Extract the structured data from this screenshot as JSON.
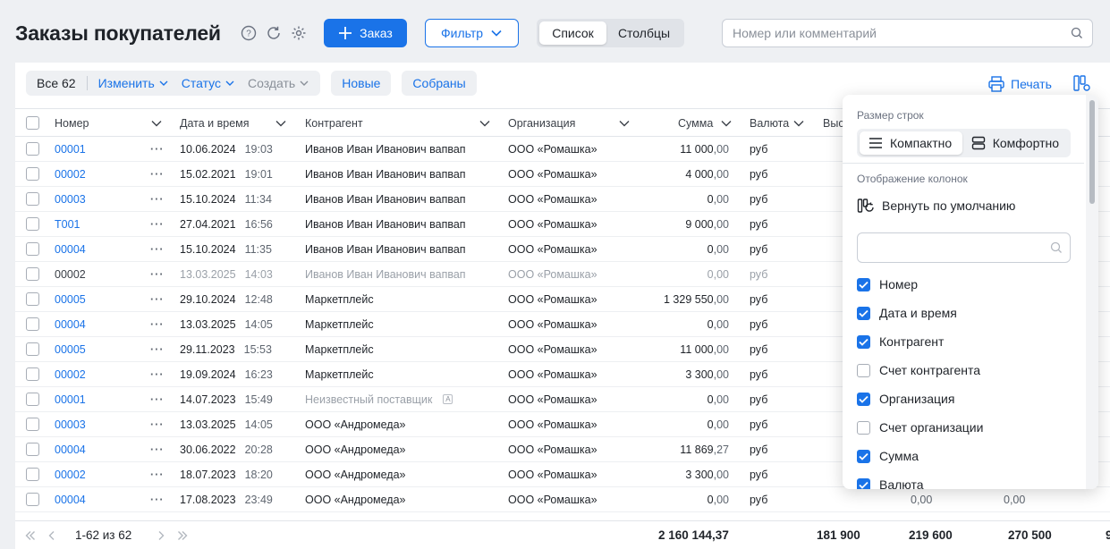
{
  "header": {
    "title": "Заказы покупателей",
    "order_button": "Заказ",
    "filter_button": "Фильтр",
    "view_tabs": [
      "Список",
      "Столбцы"
    ],
    "search_placeholder": "Номер или комментарий"
  },
  "toolbar": {
    "all_label": "Все 62",
    "edit": "Изменить",
    "status": "Статус",
    "create": "Создать",
    "chip_new": "Новые",
    "chip_collected": "Собраны",
    "print": "Печать"
  },
  "columns": [
    "Номер",
    "Дата и время",
    "Контрагент",
    "Организация",
    "Сумма",
    "Валюта",
    "Выс"
  ],
  "rows": [
    {
      "num": "00001",
      "date": "10.06.2024",
      "time": "19:03",
      "party": "Иванов Иван Иванович вапвап",
      "org": "ООО «Ромашка»",
      "sum_int": "11 000",
      "sum_dec": ",00",
      "cur": "руб",
      "style": "link"
    },
    {
      "num": "00002",
      "date": "15.02.2021",
      "time": "19:01",
      "party": "Иванов Иван Иванович вапвап",
      "org": "ООО «Ромашка»",
      "sum_int": "4 000",
      "sum_dec": ",00",
      "cur": "руб",
      "style": "link"
    },
    {
      "num": "00003",
      "date": "15.10.2024",
      "time": "11:34",
      "party": "Иванов Иван Иванович вапвап",
      "org": "ООО «Ромашка»",
      "sum_int": "0",
      "sum_dec": ",00",
      "cur": "руб",
      "style": "link"
    },
    {
      "num": "T001",
      "date": "27.04.2021",
      "time": "16:56",
      "party": "Иванов Иван Иванович вапвап",
      "org": "ООО «Ромашка»",
      "sum_int": "9 000",
      "sum_dec": ",00",
      "cur": "руб",
      "style": "link"
    },
    {
      "num": "00004",
      "date": "15.10.2024",
      "time": "11:35",
      "party": "Иванов Иван Иванович вапвап",
      "org": "ООО «Ромашка»",
      "sum_int": "0",
      "sum_dec": ",00",
      "cur": "руб",
      "style": "link"
    },
    {
      "num": "00002",
      "date": "13.03.2025",
      "time": "14:03",
      "party": "Иванов Иван Иванович вапвап",
      "org": "ООО «Ромашка»",
      "sum_int": "0",
      "sum_dec": ",00",
      "cur": "руб",
      "style": "dim"
    },
    {
      "num": "00005",
      "date": "29.10.2024",
      "time": "12:48",
      "party": "Маркетплейс",
      "org": "ООО «Ромашка»",
      "sum_int": "1 329 550",
      "sum_dec": ",00",
      "cur": "руб",
      "style": "link"
    },
    {
      "num": "00004",
      "date": "13.03.2025",
      "time": "14:05",
      "party": "Маркетплейс",
      "org": "ООО «Ромашка»",
      "sum_int": "0",
      "sum_dec": ",00",
      "cur": "руб",
      "style": "link"
    },
    {
      "num": "00005",
      "date": "29.11.2023",
      "time": "15:53",
      "party": "Маркетплейс",
      "org": "ООО «Ромашка»",
      "sum_int": "11 000",
      "sum_dec": ",00",
      "cur": "руб",
      "style": "link"
    },
    {
      "num": "00002",
      "date": "19.09.2024",
      "time": "16:23",
      "party": "Маркетплейс",
      "org": "ООО «Ромашка»",
      "sum_int": "3 300",
      "sum_dec": ",00",
      "cur": "руб",
      "style": "link"
    },
    {
      "num": "00001",
      "date": "14.07.2023",
      "time": "15:49",
      "party": "Неизвестный поставщик",
      "org": "ООО «Ромашка»",
      "sum_int": "0",
      "sum_dec": ",00",
      "cur": "руб",
      "style": "link",
      "party_dim": true
    },
    {
      "num": "00003",
      "date": "13.03.2025",
      "time": "14:05",
      "party": "ООО «Андромеда»",
      "org": "ООО «Ромашка»",
      "sum_int": "0",
      "sum_dec": ",00",
      "cur": "руб",
      "style": "link"
    },
    {
      "num": "00004",
      "date": "30.06.2022",
      "time": "20:28",
      "party": "ООО «Андромеда»",
      "org": "ООО «Ромашка»",
      "sum_int": "11 869",
      "sum_dec": ",27",
      "cur": "руб",
      "style": "link"
    },
    {
      "num": "00002",
      "date": "18.07.2023",
      "time": "18:20",
      "party": "ООО «Андромеда»",
      "org": "ООО «Ромашка»",
      "sum_int": "3 300",
      "sum_dec": ",00",
      "cur": "руб",
      "style": "link"
    },
    {
      "num": "00004",
      "date": "17.08.2023",
      "time": "23:49",
      "party": "ООО «Андромеда»",
      "org": "ООО «Ромашка»",
      "sum_int": "0",
      "sum_dec": ",00",
      "cur": "руб",
      "style": "link",
      "extra": [
        "0,00",
        "0,00"
      ]
    }
  ],
  "footer": {
    "pages": "1-62 из 62",
    "totals": [
      "2 160 144,37",
      "181 900",
      "219 600",
      "270 500",
      "9"
    ]
  },
  "dropdown": {
    "row_size_label": "Размер строк",
    "compact": "Компактно",
    "comfort": "Комфортно",
    "columns_label": "Отображение колонок",
    "reset": "Вернуть по умолчанию",
    "items": [
      {
        "label": "Номер",
        "checked": true
      },
      {
        "label": "Дата и время",
        "checked": true
      },
      {
        "label": "Контрагент",
        "checked": true
      },
      {
        "label": "Счет контрагента",
        "checked": false
      },
      {
        "label": "Организация",
        "checked": true
      },
      {
        "label": "Счет организации",
        "checked": false
      },
      {
        "label": "Сумма",
        "checked": true
      },
      {
        "label": "Валюта",
        "checked": true
      }
    ]
  },
  "colors": {
    "accent": "#1a73e8",
    "bg": "#eef0f3"
  }
}
